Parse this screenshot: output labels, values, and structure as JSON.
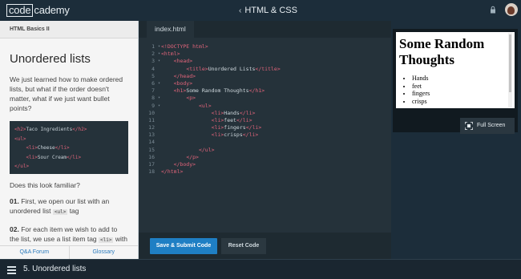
{
  "header": {
    "logo_code": "code",
    "logo_academy": "cademy",
    "breadcrumb": "HTML & CSS",
    "icons": [
      "chevron-left-icon",
      "lock-icon",
      "avatar"
    ]
  },
  "lesson": {
    "section": "HTML Basics II",
    "title": "Unordered lists",
    "intro": "We just learned how to make ordered lists, but what if the order doesn't matter, what if we just want bullet points?",
    "snippet": [
      {
        "tag_open": "<h2>",
        "text": "Taco Ingredients",
        "tag_close": "</h2>",
        "indent": ""
      },
      {
        "tag_open": "<ul>",
        "text": "",
        "tag_close": "",
        "indent": ""
      },
      {
        "tag_open": "<li>",
        "text": "Cheese",
        "tag_close": "</li>",
        "indent": "    "
      },
      {
        "tag_open": "<li>",
        "text": "Sour Cream",
        "tag_close": "</li>",
        "indent": "    "
      },
      {
        "tag_open": "</ul>",
        "text": "",
        "tag_close": "",
        "indent": ""
      }
    ],
    "familiar": "Does this look familiar?",
    "step1_num": "01.",
    "step1_text": " First, we open our list with an unordered list ",
    "step1_code": "<ul>",
    "step1_tail": " tag",
    "step2_num": "02.",
    "step2_text": " For each item we wish to add to the list, we use a list item tag ",
    "step2_code": "<li>",
    "step2_tail": " with text in between",
    "footer_left": "Q&A Forum",
    "footer_right": "Glossary"
  },
  "editor": {
    "tab": "index.html",
    "lines": [
      {
        "n": "1",
        "fold": true,
        "indent": "",
        "parts": [
          [
            "t",
            "<!DOCTYPE html>"
          ]
        ]
      },
      {
        "n": "2",
        "fold": true,
        "indent": "",
        "parts": [
          [
            "t",
            "<html>"
          ]
        ]
      },
      {
        "n": "3",
        "fold": true,
        "indent": "    ",
        "parts": [
          [
            "t",
            "<head>"
          ]
        ]
      },
      {
        "n": "4",
        "fold": false,
        "indent": "        ",
        "parts": [
          [
            "t",
            "<title>"
          ],
          [
            "x",
            "Unordered Lists"
          ],
          [
            "t",
            "</title>"
          ]
        ]
      },
      {
        "n": "5",
        "fold": false,
        "indent": "    ",
        "parts": [
          [
            "t",
            "</head>"
          ]
        ]
      },
      {
        "n": "6",
        "fold": true,
        "indent": "    ",
        "parts": [
          [
            "t",
            "<body>"
          ]
        ]
      },
      {
        "n": "7",
        "fold": false,
        "indent": "    ",
        "parts": [
          [
            "t",
            "<h1>"
          ],
          [
            "x",
            "Some Random Thoughts"
          ],
          [
            "t",
            "</h1>"
          ]
        ]
      },
      {
        "n": "8",
        "fold": true,
        "indent": "        ",
        "parts": [
          [
            "t",
            "<p>"
          ]
        ]
      },
      {
        "n": "9",
        "fold": true,
        "indent": "            ",
        "parts": [
          [
            "t",
            "<ul>"
          ]
        ]
      },
      {
        "n": "10",
        "fold": false,
        "indent": "                ",
        "parts": [
          [
            "t",
            "<li>"
          ],
          [
            "x",
            "Hands"
          ],
          [
            "t",
            "</li>"
          ]
        ]
      },
      {
        "n": "11",
        "fold": false,
        "indent": "                ",
        "parts": [
          [
            "t",
            "<li>"
          ],
          [
            "x",
            "feet"
          ],
          [
            "t",
            "</li>"
          ]
        ]
      },
      {
        "n": "12",
        "fold": false,
        "indent": "                ",
        "parts": [
          [
            "t",
            "<li>"
          ],
          [
            "x",
            "fingers"
          ],
          [
            "t",
            "</li>"
          ]
        ]
      },
      {
        "n": "13",
        "fold": false,
        "indent": "                ",
        "parts": [
          [
            "t",
            "<li>"
          ],
          [
            "x",
            "crisps"
          ],
          [
            "t",
            "</li>"
          ]
        ]
      },
      {
        "n": "14",
        "fold": false,
        "indent": "",
        "parts": []
      },
      {
        "n": "15",
        "fold": false,
        "indent": "            ",
        "parts": [
          [
            "t",
            "</ul>"
          ]
        ]
      },
      {
        "n": "16",
        "fold": false,
        "indent": "        ",
        "parts": [
          [
            "t",
            "</p>"
          ]
        ]
      },
      {
        "n": "17",
        "fold": false,
        "indent": "    ",
        "parts": [
          [
            "t",
            "</body>"
          ]
        ]
      },
      {
        "n": "18",
        "fold": false,
        "indent": "",
        "parts": [
          [
            "t",
            "</html>"
          ]
        ]
      }
    ],
    "submit_label": "Save & Submit Code",
    "reset_label": "Reset Code"
  },
  "preview": {
    "heading": "Some Random Thoughts",
    "items": [
      "Hands",
      "feet",
      "fingers",
      "crisps"
    ],
    "fullscreen_label": "Full Screen"
  },
  "bottom": {
    "label": "5. Unordered lists"
  },
  "colors": {
    "accent": "#1f7fc4",
    "tag": "#e0647a",
    "editor_bg": "#25323a"
  }
}
